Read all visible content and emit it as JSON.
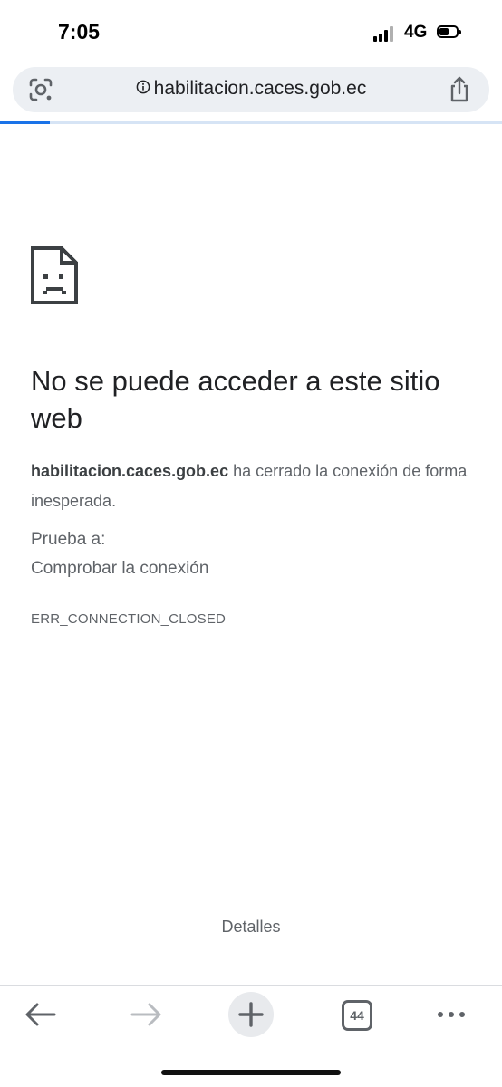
{
  "status_bar": {
    "time": "7:05",
    "network": "4G",
    "battery_level": 0.55
  },
  "address_bar": {
    "url": "habilitacion.caces.gob.ec",
    "lens_icon": "lens-icon",
    "info_icon": "info-icon",
    "share_icon": "share-icon"
  },
  "page_load_progress": 0.1,
  "error_page": {
    "icon": "sad-document-icon",
    "title": "No se puede acceder a este sitio web",
    "host_bold": "habilitacion.caces.gob.ec",
    "message": " ha cerrado la conexión de forma inesperada.",
    "try_label": "Prueba a:",
    "suggestion": "Comprobar la conexión",
    "error_code": "ERR_CONNECTION_CLOSED",
    "details_label": "Detalles"
  },
  "toolbar": {
    "tab_count": "44",
    "icons": [
      "back-arrow-icon",
      "forward-arrow-icon",
      "plus-icon",
      "tab-switcher-icon",
      "more-dots-icon"
    ]
  },
  "colors": {
    "accent": "#1a73e8",
    "text_primary": "#202124",
    "text_secondary": "#5f6368",
    "address_bg": "#eceff3"
  }
}
